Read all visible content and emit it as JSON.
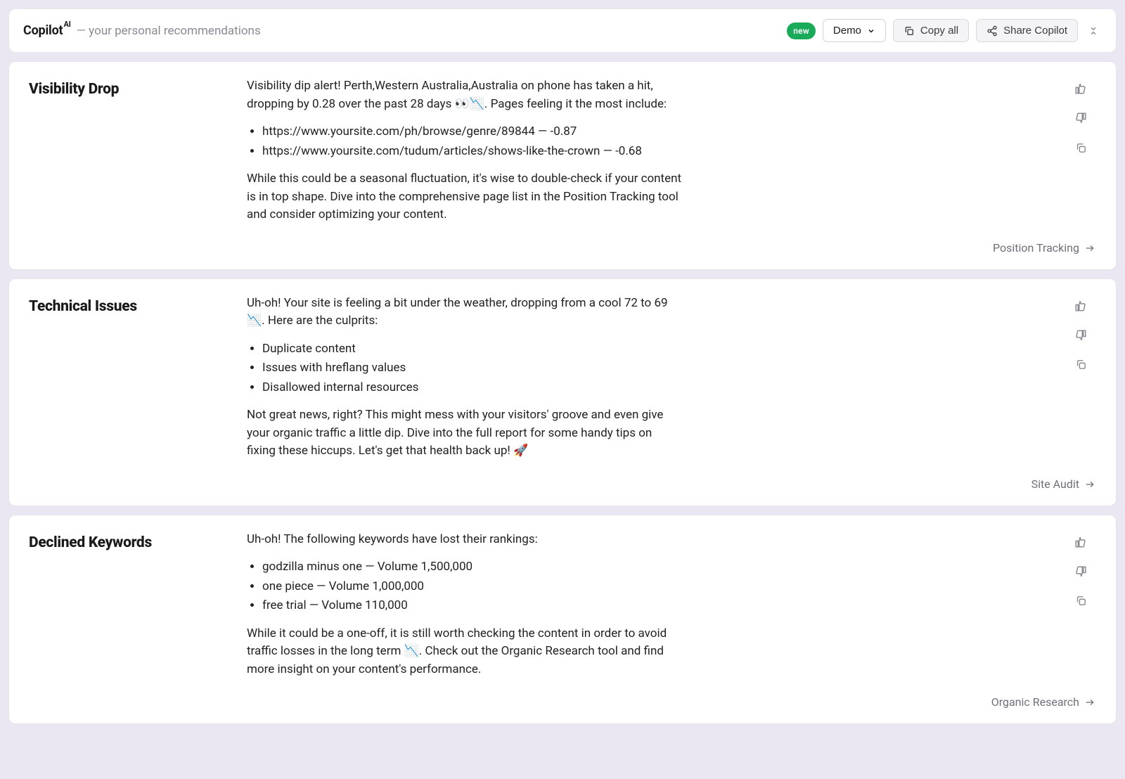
{
  "header": {
    "brand": "Copilot",
    "brand_sup": "AI",
    "subtitle": "— your personal recommendations",
    "badge_new": "new",
    "demo_label": "Demo",
    "copy_all_label": "Copy all",
    "share_label": "Share Copilot"
  },
  "cards": [
    {
      "title": "Visibility Drop",
      "intro": "Visibility dip alert! Perth,Western Australia,Australia on phone has taken a hit, dropping by 0.28 over the past 28 days 👀📉. Pages feeling it the most include:",
      "items": [
        "https://www.yoursite.com/ph/browse/genre/89844 — -0.87",
        "https://www.yoursite.com/tudum/articles/shows-like-the-crown — -0.68"
      ],
      "outro": "While this could be a seasonal fluctuation, it's wise to double-check if your content is in top shape. Dive into the comprehensive page list in the Position Tracking tool and consider optimizing your content.",
      "footer_link": "Position Tracking"
    },
    {
      "title": "Technical Issues",
      "intro": "Uh-oh! Your site is feeling a bit under the weather, dropping from a cool 72 to 69 📉. Here are the culprits:",
      "items": [
        "Duplicate content",
        "Issues with hreflang values",
        "Disallowed internal resources"
      ],
      "outro": "Not great news, right? This might mess with your visitors' groove and even give your organic traffic a little dip. Dive into the full report for some handy tips on fixing these hiccups. Let's get that health back up! 🚀",
      "footer_link": "Site Audit"
    },
    {
      "title": "Declined Keywords",
      "intro": "Uh-oh! The following keywords have lost their rankings:",
      "items": [
        "godzilla minus one — Volume 1,500,000",
        "one piece — Volume 1,000,000",
        "free trial — Volume 110,000"
      ],
      "outro": "While it could be a one-off, it is still worth checking the content in order to avoid traffic losses in the long term 📉. Check out the Organic Research tool and find more insight on your content's performance.",
      "footer_link": "Organic Research"
    }
  ]
}
